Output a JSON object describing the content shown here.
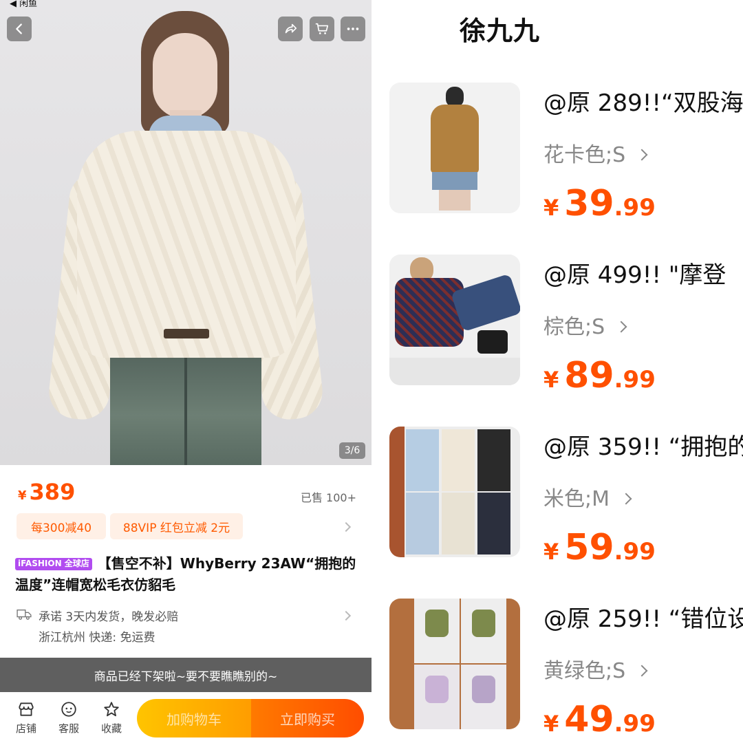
{
  "status_bar": {
    "back_app": "◀ 闲鱼"
  },
  "left": {
    "page_indicator": "3/6",
    "price": {
      "currency": "¥",
      "value": "389"
    },
    "sold": "已售 100+",
    "promos": [
      "每300减40",
      "88VIP 红包立减 2元"
    ],
    "store_badge": "iFASHION 全球店",
    "title": "【售空不补】WhyBerry 23AW“拥抱的温度”连帽宽松毛衣仿貂毛",
    "shipping": {
      "promise": "承诺 3天内发货，晚发必赔",
      "location_fee": "浙江杭州  快递: 免运费"
    },
    "offshelf_notice": "商品已经下架啦~要不要瞧瞧别的~",
    "bottom_bar": {
      "store": "店铺",
      "service": "客服",
      "favorite": "收藏",
      "add_cart": "加购物车",
      "buy_now": "立即购买"
    },
    "colors": {
      "accent": "#ff5000",
      "cart_gradient_start": "#ffc400",
      "buy_gradient_end": "#ff4d00"
    }
  },
  "right": {
    "shop_name": "徐九九",
    "orders": [
      {
        "title": "@原 289!!“双股海",
        "spec": "花卡色;S",
        "price_currency": "¥",
        "price_int": "39",
        "price_dec": ".99"
      },
      {
        "title": "@原 499!!  \"摩登",
        "spec": "棕色;S",
        "price_currency": "¥",
        "price_int": "89",
        "price_dec": ".99"
      },
      {
        "title": "@原 359!! “拥抱的",
        "spec": "米色;M",
        "price_currency": "¥",
        "price_int": "59",
        "price_dec": ".99"
      },
      {
        "title": "@原 259!! “错位设",
        "spec": "黄绿色;S",
        "price_currency": "¥",
        "price_int": "49",
        "price_dec": ".99"
      }
    ]
  }
}
